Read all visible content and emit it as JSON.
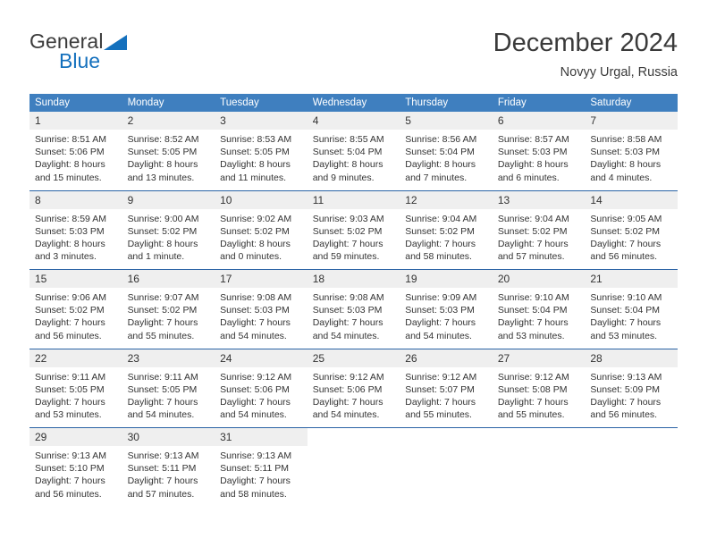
{
  "brand": {
    "name_part1": "General",
    "name_part2": "Blue",
    "logo_icon": "blue-triangle-icon"
  },
  "header": {
    "title": "December 2024",
    "subtitle": "Novyy Urgal, Russia"
  },
  "colors": {
    "header_blue": "#3f7fbf",
    "rule_blue": "#2a63a5",
    "brand_blue": "#1470bd",
    "daynum_band": "#efefef",
    "text": "#333333"
  },
  "weekday_headers": [
    "Sunday",
    "Monday",
    "Tuesday",
    "Wednesday",
    "Thursday",
    "Friday",
    "Saturday"
  ],
  "weeks": [
    {
      "days": [
        {
          "num": "1",
          "sunrise": "Sunrise: 8:51 AM",
          "sunset": "Sunset: 5:06 PM",
          "daylight1": "Daylight: 8 hours",
          "daylight2": "and 15 minutes."
        },
        {
          "num": "2",
          "sunrise": "Sunrise: 8:52 AM",
          "sunset": "Sunset: 5:05 PM",
          "daylight1": "Daylight: 8 hours",
          "daylight2": "and 13 minutes."
        },
        {
          "num": "3",
          "sunrise": "Sunrise: 8:53 AM",
          "sunset": "Sunset: 5:05 PM",
          "daylight1": "Daylight: 8 hours",
          "daylight2": "and 11 minutes."
        },
        {
          "num": "4",
          "sunrise": "Sunrise: 8:55 AM",
          "sunset": "Sunset: 5:04 PM",
          "daylight1": "Daylight: 8 hours",
          "daylight2": "and 9 minutes."
        },
        {
          "num": "5",
          "sunrise": "Sunrise: 8:56 AM",
          "sunset": "Sunset: 5:04 PM",
          "daylight1": "Daylight: 8 hours",
          "daylight2": "and 7 minutes."
        },
        {
          "num": "6",
          "sunrise": "Sunrise: 8:57 AM",
          "sunset": "Sunset: 5:03 PM",
          "daylight1": "Daylight: 8 hours",
          "daylight2": "and 6 minutes."
        },
        {
          "num": "7",
          "sunrise": "Sunrise: 8:58 AM",
          "sunset": "Sunset: 5:03 PM",
          "daylight1": "Daylight: 8 hours",
          "daylight2": "and 4 minutes."
        }
      ]
    },
    {
      "days": [
        {
          "num": "8",
          "sunrise": "Sunrise: 8:59 AM",
          "sunset": "Sunset: 5:03 PM",
          "daylight1": "Daylight: 8 hours",
          "daylight2": "and 3 minutes."
        },
        {
          "num": "9",
          "sunrise": "Sunrise: 9:00 AM",
          "sunset": "Sunset: 5:02 PM",
          "daylight1": "Daylight: 8 hours",
          "daylight2": "and 1 minute."
        },
        {
          "num": "10",
          "sunrise": "Sunrise: 9:02 AM",
          "sunset": "Sunset: 5:02 PM",
          "daylight1": "Daylight: 8 hours",
          "daylight2": "and 0 minutes."
        },
        {
          "num": "11",
          "sunrise": "Sunrise: 9:03 AM",
          "sunset": "Sunset: 5:02 PM",
          "daylight1": "Daylight: 7 hours",
          "daylight2": "and 59 minutes."
        },
        {
          "num": "12",
          "sunrise": "Sunrise: 9:04 AM",
          "sunset": "Sunset: 5:02 PM",
          "daylight1": "Daylight: 7 hours",
          "daylight2": "and 58 minutes."
        },
        {
          "num": "13",
          "sunrise": "Sunrise: 9:04 AM",
          "sunset": "Sunset: 5:02 PM",
          "daylight1": "Daylight: 7 hours",
          "daylight2": "and 57 minutes."
        },
        {
          "num": "14",
          "sunrise": "Sunrise: 9:05 AM",
          "sunset": "Sunset: 5:02 PM",
          "daylight1": "Daylight: 7 hours",
          "daylight2": "and 56 minutes."
        }
      ]
    },
    {
      "days": [
        {
          "num": "15",
          "sunrise": "Sunrise: 9:06 AM",
          "sunset": "Sunset: 5:02 PM",
          "daylight1": "Daylight: 7 hours",
          "daylight2": "and 56 minutes."
        },
        {
          "num": "16",
          "sunrise": "Sunrise: 9:07 AM",
          "sunset": "Sunset: 5:02 PM",
          "daylight1": "Daylight: 7 hours",
          "daylight2": "and 55 minutes."
        },
        {
          "num": "17",
          "sunrise": "Sunrise: 9:08 AM",
          "sunset": "Sunset: 5:03 PM",
          "daylight1": "Daylight: 7 hours",
          "daylight2": "and 54 minutes."
        },
        {
          "num": "18",
          "sunrise": "Sunrise: 9:08 AM",
          "sunset": "Sunset: 5:03 PM",
          "daylight1": "Daylight: 7 hours",
          "daylight2": "and 54 minutes."
        },
        {
          "num": "19",
          "sunrise": "Sunrise: 9:09 AM",
          "sunset": "Sunset: 5:03 PM",
          "daylight1": "Daylight: 7 hours",
          "daylight2": "and 54 minutes."
        },
        {
          "num": "20",
          "sunrise": "Sunrise: 9:10 AM",
          "sunset": "Sunset: 5:04 PM",
          "daylight1": "Daylight: 7 hours",
          "daylight2": "and 53 minutes."
        },
        {
          "num": "21",
          "sunrise": "Sunrise: 9:10 AM",
          "sunset": "Sunset: 5:04 PM",
          "daylight1": "Daylight: 7 hours",
          "daylight2": "and 53 minutes."
        }
      ]
    },
    {
      "days": [
        {
          "num": "22",
          "sunrise": "Sunrise: 9:11 AM",
          "sunset": "Sunset: 5:05 PM",
          "daylight1": "Daylight: 7 hours",
          "daylight2": "and 53 minutes."
        },
        {
          "num": "23",
          "sunrise": "Sunrise: 9:11 AM",
          "sunset": "Sunset: 5:05 PM",
          "daylight1": "Daylight: 7 hours",
          "daylight2": "and 54 minutes."
        },
        {
          "num": "24",
          "sunrise": "Sunrise: 9:12 AM",
          "sunset": "Sunset: 5:06 PM",
          "daylight1": "Daylight: 7 hours",
          "daylight2": "and 54 minutes."
        },
        {
          "num": "25",
          "sunrise": "Sunrise: 9:12 AM",
          "sunset": "Sunset: 5:06 PM",
          "daylight1": "Daylight: 7 hours",
          "daylight2": "and 54 minutes."
        },
        {
          "num": "26",
          "sunrise": "Sunrise: 9:12 AM",
          "sunset": "Sunset: 5:07 PM",
          "daylight1": "Daylight: 7 hours",
          "daylight2": "and 55 minutes."
        },
        {
          "num": "27",
          "sunrise": "Sunrise: 9:12 AM",
          "sunset": "Sunset: 5:08 PM",
          "daylight1": "Daylight: 7 hours",
          "daylight2": "and 55 minutes."
        },
        {
          "num": "28",
          "sunrise": "Sunrise: 9:13 AM",
          "sunset": "Sunset: 5:09 PM",
          "daylight1": "Daylight: 7 hours",
          "daylight2": "and 56 minutes."
        }
      ]
    },
    {
      "days": [
        {
          "num": "29",
          "sunrise": "Sunrise: 9:13 AM",
          "sunset": "Sunset: 5:10 PM",
          "daylight1": "Daylight: 7 hours",
          "daylight2": "and 56 minutes."
        },
        {
          "num": "30",
          "sunrise": "Sunrise: 9:13 AM",
          "sunset": "Sunset: 5:11 PM",
          "daylight1": "Daylight: 7 hours",
          "daylight2": "and 57 minutes."
        },
        {
          "num": "31",
          "sunrise": "Sunrise: 9:13 AM",
          "sunset": "Sunset: 5:11 PM",
          "daylight1": "Daylight: 7 hours",
          "daylight2": "and 58 minutes."
        },
        {
          "num": "",
          "sunrise": "",
          "sunset": "",
          "daylight1": "",
          "daylight2": ""
        },
        {
          "num": "",
          "sunrise": "",
          "sunset": "",
          "daylight1": "",
          "daylight2": ""
        },
        {
          "num": "",
          "sunrise": "",
          "sunset": "",
          "daylight1": "",
          "daylight2": ""
        },
        {
          "num": "",
          "sunrise": "",
          "sunset": "",
          "daylight1": "",
          "daylight2": ""
        }
      ]
    }
  ]
}
